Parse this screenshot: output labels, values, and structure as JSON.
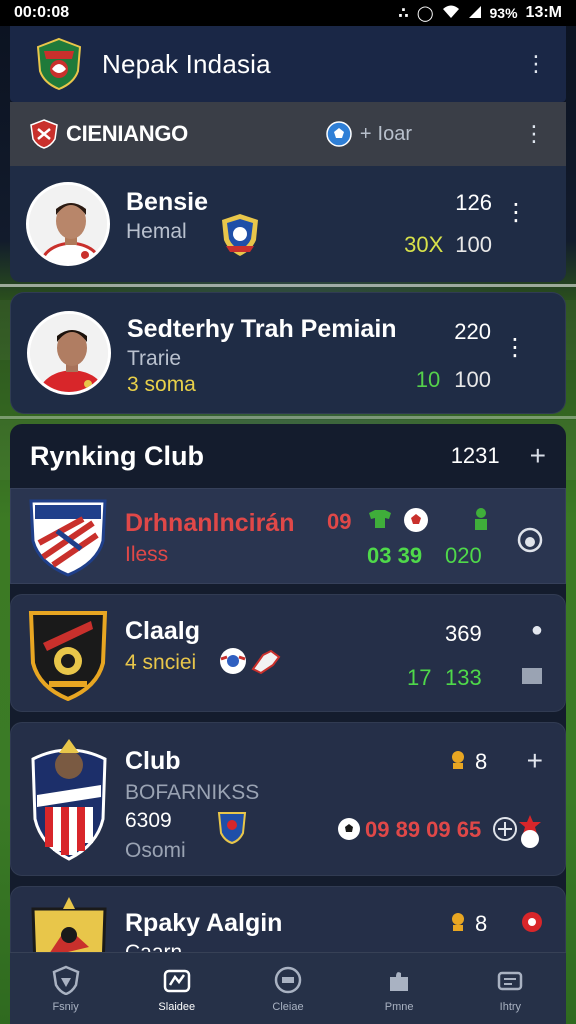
{
  "status_bar": {
    "time": "00:0:08",
    "battery": "93%",
    "clock": "13:M"
  },
  "header": {
    "title": "Nepak Indasia"
  },
  "league": {
    "name": "CIENIANGO",
    "count_prefix": "+",
    "count_label": "Ioar"
  },
  "players": [
    {
      "name": "Bensie",
      "sub": "Hemal",
      "score_top": "126",
      "highlight": "30X",
      "score_bottom": "100"
    },
    {
      "name": "Sedterhy Trah Pemiain",
      "sub": "Trarie",
      "sub2": "3 soma",
      "score_top": "220",
      "highlight": "10",
      "score_bottom": "100"
    }
  ],
  "ranking": {
    "title": "Rynking Club",
    "count": "1231"
  },
  "clubs": [
    {
      "name": "Drhnanlncirán",
      "sub": "Iless",
      "stat_red": "09",
      "stat_green": "03 39",
      "stat_green2": "020"
    },
    {
      "name": "Claalg",
      "sub": "4 snciei",
      "score_top": "369",
      "score_green": "17",
      "score_bottom": "133"
    },
    {
      "name": "Club",
      "sub": "BOFARNIKSS",
      "sub2": "6309",
      "sub3": "Osomi",
      "count": "8",
      "stats": "09 89 09 65"
    },
    {
      "name": "Rpaky Aalgin",
      "sub": "Caarn",
      "count": "8"
    }
  ],
  "nav": [
    {
      "label": "Fsniy",
      "icon": "shield-icon"
    },
    {
      "label": "Slaidee",
      "icon": "stadium-icon"
    },
    {
      "label": "Cleiae",
      "icon": "ball-icon"
    },
    {
      "label": "Pmne",
      "icon": "puzzle-icon"
    },
    {
      "label": "Ihtry",
      "icon": "trophy-icon"
    }
  ],
  "colors": {
    "header_bg": "#1a2746",
    "card_bg": "#1f2c45",
    "accent_green": "#4fd94a",
    "accent_red": "#e04848",
    "accent_yellow": "#e8c64a"
  }
}
